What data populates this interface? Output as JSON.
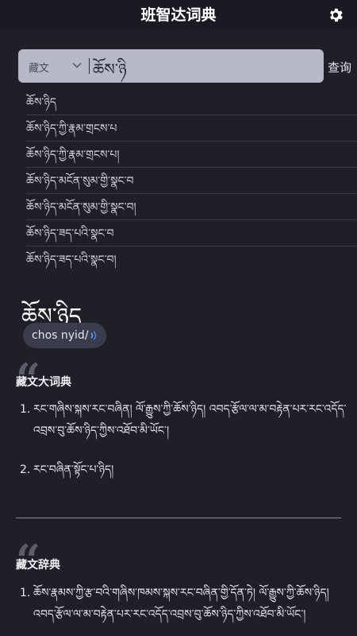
{
  "header": {
    "title": "班智达词典"
  },
  "search": {
    "language": "藏文",
    "query": "ཆོས་ཉི",
    "submit_label": "查询"
  },
  "suggestions": [
    "ཆོས་ཉིད",
    "ཆོས་ཉིད་ཀྱི་རྣམ་གྲངས་པ",
    "ཆོས་ཉིད་ཀྱི་རྣམ་གྲངས་པ།",
    "ཆོས་ཉིད་མངོན་སུམ་གྱི་སྣང་བ",
    "ཆོས་ཉིད་མངོན་སུམ་གྱི་སྣང་བ།",
    "ཆོས་ཉིད་ཟད་པའི་སྣང་བ",
    "ཆོས་ཉིད་ཟད་པའི་སྣང་བ།"
  ],
  "entry": {
    "headword": "ཆོས་ཉིད",
    "pronunciation": "chos nyid/"
  },
  "dict1": {
    "name": "藏文大词典",
    "defs": [
      {
        "num": "1.",
        "text": "རང་གཞིས་སྐས་རང་བཞིན། ལོ་རྒྱུས་ཀྱི་ཆོས་ཉིད། འབད་རྩོལ་ལ་མ་བརྟེན་པར་རང་འདོད་འབྲས་བུ་ཆོས་ཉིད་ཀྱིས་འཐོབ་མི་ཡོང་།"
      },
      {
        "num": "2.",
        "text": "རང་བཞིན་སྟོང་པ་ཉིད།"
      }
    ]
  },
  "dict2": {
    "name": "藏文辞典",
    "defs": [
      {
        "num": "1.",
        "text": "ཆོས་རྣམས་ཀྱི་རྩ་བའི་གཞིས་ཁམས་སྐས་རང་བཞིན་གྱི་དོན་ཏེ། ལོ་རྒྱུས་ཀྱི་ཆོས་ཉིད། འབད་རྩོལ་ལ་མ་བརྟེན་པར་རང་འདོད་འབྲས་བུ་ཆོས་ཉིད་ཀྱིས་འཐོབ་མི་ཡོང་།"
      }
    ]
  }
}
